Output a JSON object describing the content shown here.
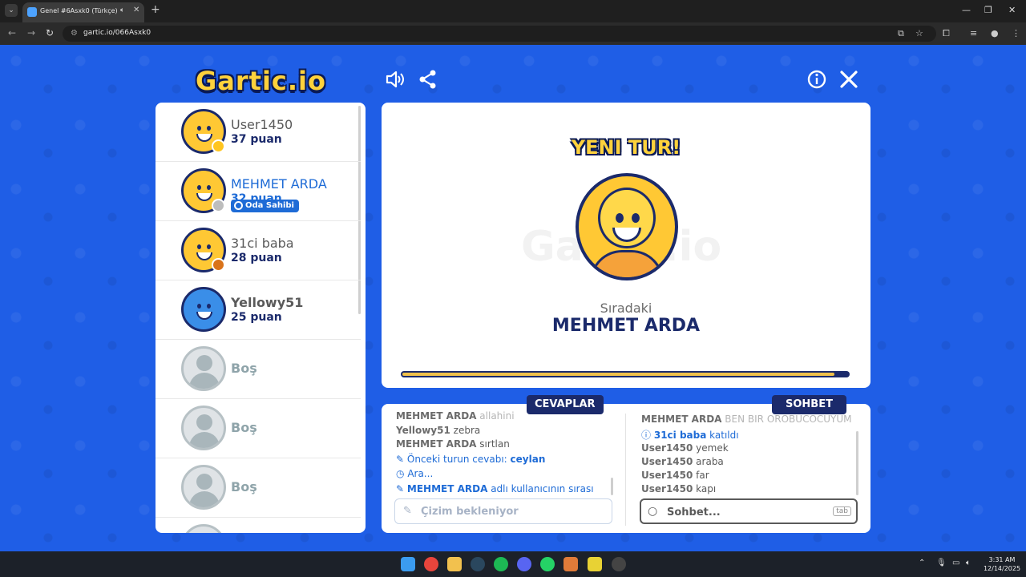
{
  "browser": {
    "tab_title": "Genel #6Asxk0 (Türkçe) - G",
    "url": "gartic.io/066Asxk0",
    "new_tab": "+",
    "tab_close": "✕",
    "win_min": "—",
    "win_max": "❐",
    "win_close": "✕"
  },
  "game": {
    "logo": "Gartic.io",
    "watermark": "Gartic.io",
    "new_round": "YENI TUR!",
    "next_label": "Sıradaki",
    "next_player": "MEHMET ARDA",
    "progress_fraction": 0.97
  },
  "players": [
    {
      "name": "User1450",
      "score": "37 puan",
      "status_color": "#ffc51f",
      "active": false
    },
    {
      "name": "MEHMET ARDA",
      "score": "32 puan",
      "status_color": "#bdbdbd",
      "active": true,
      "badge": "Oda Sahibi"
    },
    {
      "name": "31ci baba",
      "score": "28 puan",
      "status_color": "#d9731a",
      "active": false
    },
    {
      "name": "Yellowy51",
      "score": "25 puan",
      "status_color": null,
      "active": false
    }
  ],
  "empty_slot_label": "Boş",
  "answers": {
    "tab_label": "CEVAPLAR",
    "faded_line": "MEHMET ARDA",
    "faded_suffix": "allahini",
    "lines": [
      {
        "user": "Yellowy51",
        "text": "zebra"
      },
      {
        "user": "MEHMET ARDA",
        "text": "sırtlan"
      }
    ],
    "info_prev_prefix": "Önceki turun cevabı:",
    "info_prev_answer": "ceylan",
    "info_search": "Ara...",
    "info_turn_user": "MEHMET ARDA",
    "info_turn_suffix": "adlı kullanıcının sırası",
    "placeholder": "Çizim bekleniyor"
  },
  "chat": {
    "tab_label": "SOHBET",
    "faded_line": "MEHMET ARDA",
    "faded_suffix": "BEN BIR OROBUCOCUYUM",
    "join_user": "31ci baba",
    "join_text": "katıldı",
    "lines": [
      {
        "user": "User1450",
        "text": "yemek"
      },
      {
        "user": "User1450",
        "text": "araba"
      },
      {
        "user": "User1450",
        "text": "far"
      },
      {
        "user": "User1450",
        "text": "kapı"
      }
    ],
    "placeholder": "Sohbet...",
    "tab_hint": "tab"
  },
  "taskbar": {
    "time": "3:31 AM",
    "date": "12/14/2025"
  },
  "colors": {
    "bg_blue": "#1f5ee6",
    "accent_blue": "#1e6bd6",
    "navy": "#1b2a6b",
    "yellow": "#ffd23c"
  }
}
